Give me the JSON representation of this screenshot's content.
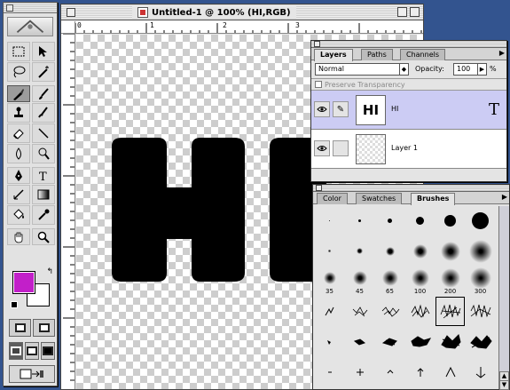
{
  "document": {
    "title": "Untitled-1 @ 100% (HI,RGB)",
    "ruler_labels": [
      "0",
      "1",
      "2",
      "3"
    ],
    "canvas_text": "HI"
  },
  "tools": {
    "foreground_color": "#c21fc9",
    "background_color": "#ffffff",
    "tool_icons": [
      "marquee-icon",
      "move-icon",
      "lasso-icon",
      "magic-wand-icon",
      "airbrush-icon",
      "paintbrush-icon",
      "rubber-stamp-icon",
      "history-brush-icon",
      "eraser-icon",
      "line-icon",
      "blur-icon",
      "dodge-icon",
      "pen-icon",
      "type-icon",
      "measure-icon",
      "gradient-icon",
      "paint-bucket-icon",
      "eyedropper-icon",
      "hand-icon",
      "zoom-icon"
    ]
  },
  "layers_palette": {
    "tabs": [
      "Layers",
      "Paths",
      "Channels"
    ],
    "active_tab": "Layers",
    "blend_mode": "Normal",
    "opacity_label": "Opacity:",
    "opacity_value": "100",
    "opacity_unit": "%",
    "preserve_label": "Preserve Transparency",
    "layers": [
      {
        "name": "HI",
        "thumb_text": "HI",
        "type_glyph": "T",
        "selected": true
      },
      {
        "name": "Layer 1",
        "selected": false
      }
    ]
  },
  "brushes_palette": {
    "tabs": [
      "Color",
      "Swatches",
      "Brushes"
    ],
    "active_tab": "Brushes",
    "size_labels": [
      "35",
      "45",
      "65",
      "100",
      "200",
      "300"
    ]
  }
}
